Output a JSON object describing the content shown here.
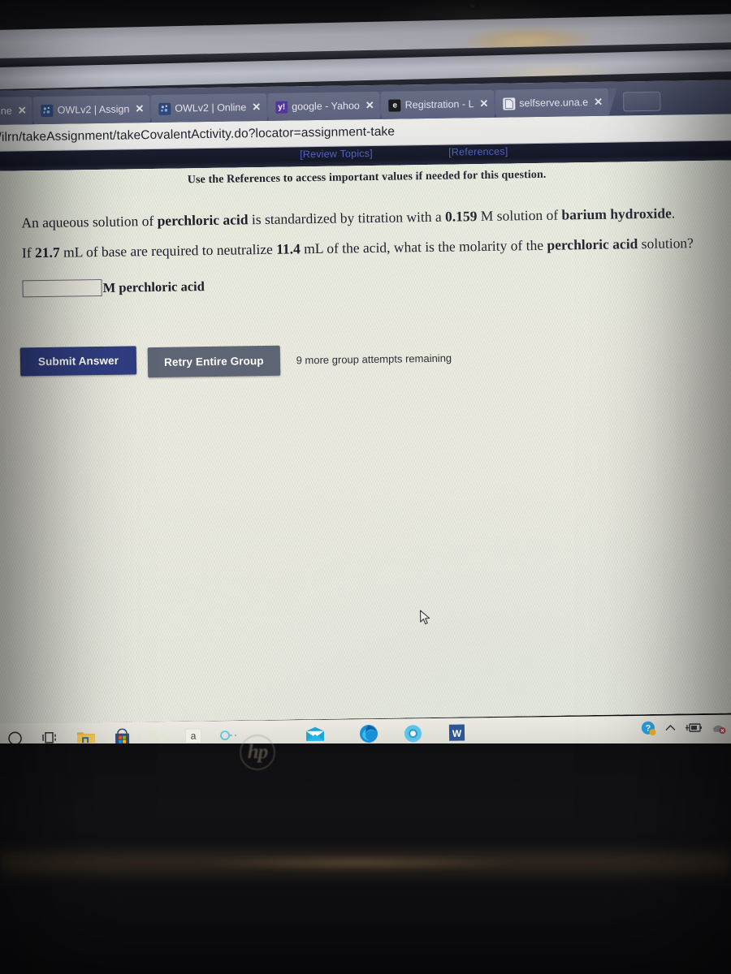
{
  "browser": {
    "tabs": [
      {
        "title": "nline",
        "favicon": "owl-favicon",
        "close": "✕",
        "truncated_left": true
      },
      {
        "title": "OWLv2 | Assign",
        "favicon": "owl-favicon",
        "close": "✕"
      },
      {
        "title": "OWLv2 | Online",
        "favicon": "owl-favicon",
        "close": "✕"
      },
      {
        "title": "google - Yahoo",
        "favicon": "yahoo-favicon",
        "favicon_text": "y!",
        "close": "✕"
      },
      {
        "title": "Registration - L",
        "favicon": "edge-favicon",
        "favicon_text": "e",
        "close": "✕"
      },
      {
        "title": "selfserve.una.e",
        "favicon": "page-favicon",
        "favicon_text": "▤",
        "close": "✕"
      }
    ],
    "new_tab_label": "+",
    "window_controls": "⌄",
    "url": "n/ilrn/takeAssignment/takeCovalentActivity.do?locator=assignment-take"
  },
  "links": {
    "review_topics": "[Review Topics]",
    "references": "[References]"
  },
  "question": {
    "instruction": "Use the References to access important values if needed for this question.",
    "line1_part1": "An aqueous solution of ",
    "line1_bold1": "perchloric acid",
    "line1_part2": " is standardized by titration with a ",
    "line1_bold2": "0.159",
    "line1_part3": " M solution of ",
    "line1_bold3": "barium hydroxide",
    "line1_part4": ".",
    "line2_part1": "If ",
    "line2_bold1": "21.7",
    "line2_part2": " mL of base are required to neutralize ",
    "line2_bold2": "11.4",
    "line2_part3": " mL of the acid, what is the molarity of the ",
    "line2_bold3": "perchloric acid",
    "line2_part4": " solution?",
    "answer_value": "",
    "answer_placeholder": "",
    "answer_unit": "M perchloric acid"
  },
  "actions": {
    "submit_label": "Submit Answer",
    "retry_label": "Retry Entire Group",
    "attempts_text": "9 more group attempts remaining"
  },
  "taskbar": {
    "items": [
      {
        "name": "cortana-circle-icon",
        "glyph": "◯"
      },
      {
        "name": "task-view-icon",
        "glyph": "❏"
      },
      {
        "name": "file-explorer-icon",
        "glyph": "🗀"
      },
      {
        "name": "microsoft-store-icon",
        "glyph": "▣"
      },
      {
        "name": "dropbox-icon",
        "glyph": "❖"
      },
      {
        "name": "amazon-icon",
        "glyph": "a"
      },
      {
        "name": "cortana-ring-icon",
        "glyph": "○"
      },
      {
        "name": "mail-icon",
        "glyph": "✉"
      },
      {
        "name": "edge-browser-icon",
        "glyph": "e"
      },
      {
        "name": "chrome-browser-icon",
        "glyph": "◎"
      },
      {
        "name": "word-icon",
        "glyph": "W"
      }
    ],
    "tray": [
      {
        "name": "help-icon",
        "glyph": "?"
      },
      {
        "name": "chevron-up-icon",
        "glyph": "^"
      },
      {
        "name": "battery-plug-icon",
        "glyph": "▭"
      },
      {
        "name": "network-offline-icon",
        "glyph": "◍"
      }
    ]
  },
  "device": {
    "brand": "hp"
  },
  "colors": {
    "accent_blue": "#2c3e91",
    "retry_gray": "#5c6477",
    "page_bg": "#e6e5d7",
    "tab_bg": "#5d6587",
    "link_blue": "#4a63d8"
  }
}
